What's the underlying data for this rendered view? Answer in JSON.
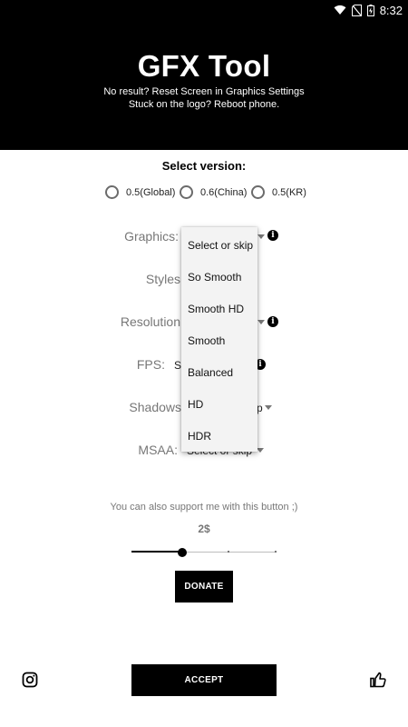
{
  "status_bar": {
    "time": "8:32",
    "icons": [
      "wifi-icon",
      "no-sim-icon",
      "battery-charging-icon"
    ]
  },
  "header": {
    "title": "GFX Tool",
    "subtitle_line1": "No result? Reset Screen in Graphics Settings",
    "subtitle_line2": "Stuck on the logo? Reboot phone."
  },
  "version": {
    "heading": "Select version:",
    "options": [
      "0.5(Global)",
      "0.6(China)",
      "0.5(KR)"
    ],
    "selected": null
  },
  "settings": {
    "graphics_label": "Graphics:",
    "styles_label": "Styles",
    "resolution_label": "Resolution",
    "fps_label": "FPS:",
    "fps_value_partial": "Se",
    "shadows_label": "Shadows",
    "shadows_value_partial": "p",
    "msaa_label": "MSAA:",
    "msaa_value": "Select or skip"
  },
  "dropdown": {
    "items": [
      "Select or skip",
      "So Smooth",
      "Smooth HD",
      "Smooth",
      "Balanced",
      "HD",
      "HDR"
    ]
  },
  "support": {
    "text": "You can also support me with this button ;)",
    "amount": "2$",
    "slider_value": 1,
    "slider_max": 3
  },
  "buttons": {
    "donate": "DONATE",
    "accept": "ACCEPT"
  },
  "bottom_icons": [
    "instagram-icon",
    "thumbs-up-icon"
  ]
}
